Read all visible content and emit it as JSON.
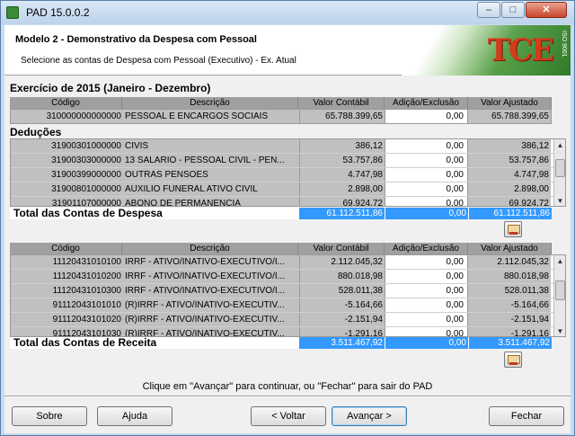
{
  "window": {
    "title": "PAD 15.0.0.2",
    "min": "–",
    "max": "□",
    "close": "✕"
  },
  "header": {
    "title": "Modelo 2 - Demonstrativo da Despesa com Pessoal",
    "subtitle": "Selecione as contas de Despesa com Pessoal (Executivo) - Ex. Atual",
    "logo_text": "TCE",
    "logo_iso": "ISO 9001"
  },
  "exercicio": "Exercício de 2015 (Janeiro - Dezembro)",
  "columns": [
    "Código",
    "Descrição",
    "Valor Contábil",
    "Adição/Exclusão",
    "Valor Ajustado"
  ],
  "main_row": {
    "codigo": "310000000000000",
    "descricao": "PESSOAL E ENCARGOS SOCIAIS",
    "valor": "65.788.399,65",
    "adicao": "0,00",
    "ajustado": "65.788.399,65"
  },
  "deducoes_label": "Deduções",
  "deducoes": [
    {
      "codigo": "31900301000000",
      "descricao": "CIVIS",
      "valor": "386,12",
      "adicao": "0,00",
      "ajustado": "386,12"
    },
    {
      "codigo": "31900303000000",
      "descricao": "13 SALARIO - PESSOAL CIVIL - PEN...",
      "valor": "53.757,86",
      "adicao": "0,00",
      "ajustado": "53.757,86"
    },
    {
      "codigo": "31900399000000",
      "descricao": "OUTRAS PENSOES",
      "valor": "4.747,98",
      "adicao": "0,00",
      "ajustado": "4.747,98"
    },
    {
      "codigo": "31900801000000",
      "descricao": "AUXILIO FUNERAL ATIVO CIVIL",
      "valor": "2.898,00",
      "adicao": "0,00",
      "ajustado": "2.898,00"
    },
    {
      "codigo": "31901107000000",
      "descricao": "ABONO DE PERMANENCIA",
      "valor": "69.924,72",
      "adicao": "0,00",
      "ajustado": "69.924,72"
    }
  ],
  "total_despesa": {
    "label": "Total das Contas de Despesa",
    "valor": "61.112.511,86",
    "adicao": "0,00",
    "ajustado": "61.112.511,86"
  },
  "receita": [
    {
      "codigo": "11120431010100",
      "descricao": "IRRF - ATIVO/INATIVO-EXECUTIVO/I...",
      "valor": "2.112.045,32",
      "adicao": "0,00",
      "ajustado": "2.112.045,32"
    },
    {
      "codigo": "11120431010200",
      "descricao": "IRRF - ATIVO/INATIVO-EXECUTIVO/I...",
      "valor": "880.018,98",
      "adicao": "0,00",
      "ajustado": "880.018,98"
    },
    {
      "codigo": "11120431010300",
      "descricao": "IRRF - ATIVO/INATIVO-EXECUTIVO/I...",
      "valor": "528.011,38",
      "adicao": "0,00",
      "ajustado": "528.011,38"
    },
    {
      "codigo": "91112043101010",
      "descricao": "(R)IRRF - ATIVO/INATIVO-EXECUTIV...",
      "valor": "-5.164,66",
      "adicao": "0,00",
      "ajustado": "-5.164,66"
    },
    {
      "codigo": "91112043101020",
      "descricao": "(R)IRRF - ATIVO/INATIVO-EXECUTIV...",
      "valor": "-2.151,94",
      "adicao": "0,00",
      "ajustado": "-2.151,94"
    },
    {
      "codigo": "91112043101030",
      "descricao": "(R)IRRF - ATIVO/INATIVO-EXECUTIV...",
      "valor": "-1.291,16",
      "adicao": "0,00",
      "ajustado": "-1.291,16"
    }
  ],
  "total_receita": {
    "label": "Total das Contas de Receita",
    "valor": "3.511.467,92",
    "adicao": "0,00",
    "ajustado": "3.511.467,92"
  },
  "message": "Clique em \"Avançar\" para continuar, ou \"Fechar\" para sair do PAD",
  "buttons": {
    "sobre": "Sobre",
    "ajuda": "Ajuda",
    "voltar": "< Voltar",
    "avancar": "Avançar >",
    "fechar": "Fechar"
  }
}
